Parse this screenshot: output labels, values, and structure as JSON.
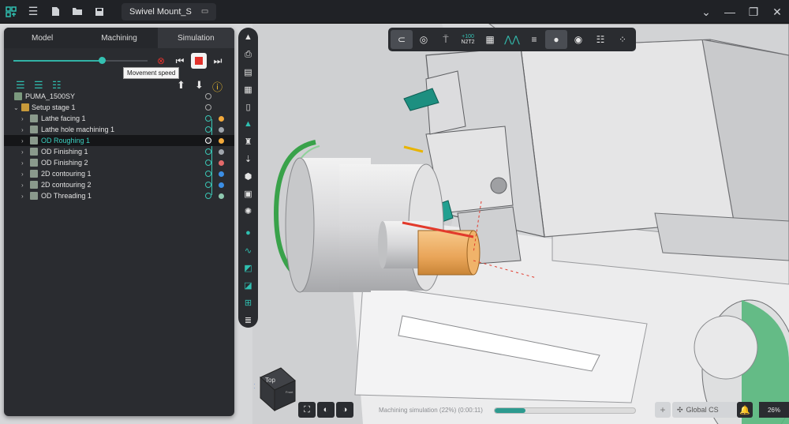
{
  "titlebar": {
    "document_tab": "Swivel Mount_S",
    "icons": [
      "app-logo-icon",
      "menu-icon",
      "new-file-icon",
      "open-folder-icon",
      "save-icon",
      "tab-monitor-icon",
      "chevron-down-icon",
      "minimize-icon",
      "restore-icon",
      "close-icon"
    ]
  },
  "panel": {
    "tabs": [
      {
        "label": "Model",
        "active": false
      },
      {
        "label": "Machining",
        "active": false
      },
      {
        "label": "Simulation",
        "active": true
      }
    ],
    "movement_speed": 0.66,
    "tooltip": "Movement speed",
    "tree": {
      "machine": "PUMA_1500SY",
      "setup": "Setup stage 1",
      "operations": [
        {
          "label": "Lathe facing 1",
          "color": "#f2a93b"
        },
        {
          "label": "Lathe hole machining 1",
          "color": "#a0a6ad"
        },
        {
          "label": "OD Roughing 1",
          "color": "#f2a93b",
          "selected": true
        },
        {
          "label": "OD Finishing 1",
          "color": "#a0a6ad"
        },
        {
          "label": "OD Finishing 2",
          "color": "#e46a6a"
        },
        {
          "label": "2D contouring 1",
          "color": "#3b8fe6"
        },
        {
          "label": "2D contouring 2",
          "color": "#3b8fe6"
        },
        {
          "label": "OD Threading 1",
          "color": "#8ec9b0"
        }
      ]
    }
  },
  "top_toolbar": {
    "icons": [
      "magnet-snap-icon",
      "measure-icon",
      "tool-holder-icon",
      "n2t2-counter-icon",
      "calculator-icon",
      "wave-icon",
      "layers-icon",
      "toggle-icon",
      "target-icon",
      "sliders-icon",
      "grid-icon"
    ],
    "counter_top": "+100",
    "counter_bottom": "N2T2"
  },
  "bottom_bar": {
    "status": "Machining simulation (22%) (0:00:11)",
    "progress": 0.22,
    "coordinate_system": "Global CS",
    "zoom": "26%"
  },
  "view_cube": {
    "face": "Top",
    "side": "Front",
    "axis": "Z"
  }
}
